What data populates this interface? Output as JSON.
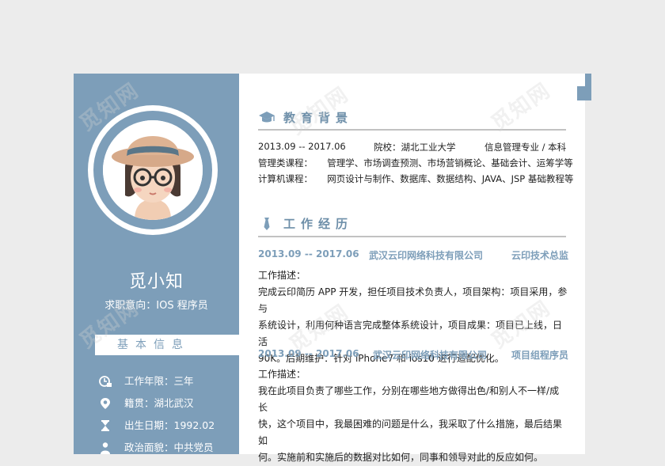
{
  "profile": {
    "name": "觅小知",
    "intent": "求职意向：IOS 程序员"
  },
  "basic": {
    "title": "基本信息",
    "items": [
      {
        "icon": "briefcase-icon",
        "label": "工作年限：三年"
      },
      {
        "icon": "location-pin-icon",
        "label": "籍贯：湖北武汉"
      },
      {
        "icon": "hourglass-icon",
        "label": "出生日期：1992.02"
      },
      {
        "icon": "person-icon",
        "label": "政治面貌：中共党员"
      }
    ]
  },
  "education": {
    "title": "教育背景",
    "period": "2013.09 -- 2017.06",
    "school": "院校：湖北工业大学",
    "major": "信息管理专业 / 本科",
    "courses1": "管理类课程：     管理学、市场调查预测、市场营销概论、基础会计、运筹学等",
    "courses2": "计算机课程：     网页设计与制作、数据库、数据结构、JAVA、JSP 基础教程等"
  },
  "work": {
    "title": "工作经历",
    "jobs": [
      {
        "period": "2013.09 -- 2017.06",
        "company": "武汉云印网络科技有限公司",
        "role": "云印技术总监",
        "desc_label": "工作描述：",
        "desc_lines": [
          "完成云印简历 APP 开发，担任项目技术负责人，项目架构：项目采用，参与",
          "系统设计，利用何种语言完成整体系统设计，项目成果：项目已上线，日活",
          "90K。后期维护：针对 iPhone7 和 ios10 进行适配优化。"
        ]
      },
      {
        "period": "2013.09 -- 2017.06",
        "company": "武汉云印网络科技有限公司",
        "role": "项目组程序员",
        "desc_label": "工作描述：",
        "desc_lines": [
          "我在此项目负责了哪些工作，分别在哪些地方做得出色/和别人不一样/成长",
          "快，这个项目中，我最困难的问题是什么，我采取了什么措施，最后结果如",
          "何。实施前和实施后的数据对比如何，同事和领导对此的反应如何。"
        ]
      }
    ]
  },
  "watermark": "觅知网",
  "colors": {
    "accent": "#7d9eb9",
    "title": "#6e8fa9",
    "background": "#ececec"
  }
}
